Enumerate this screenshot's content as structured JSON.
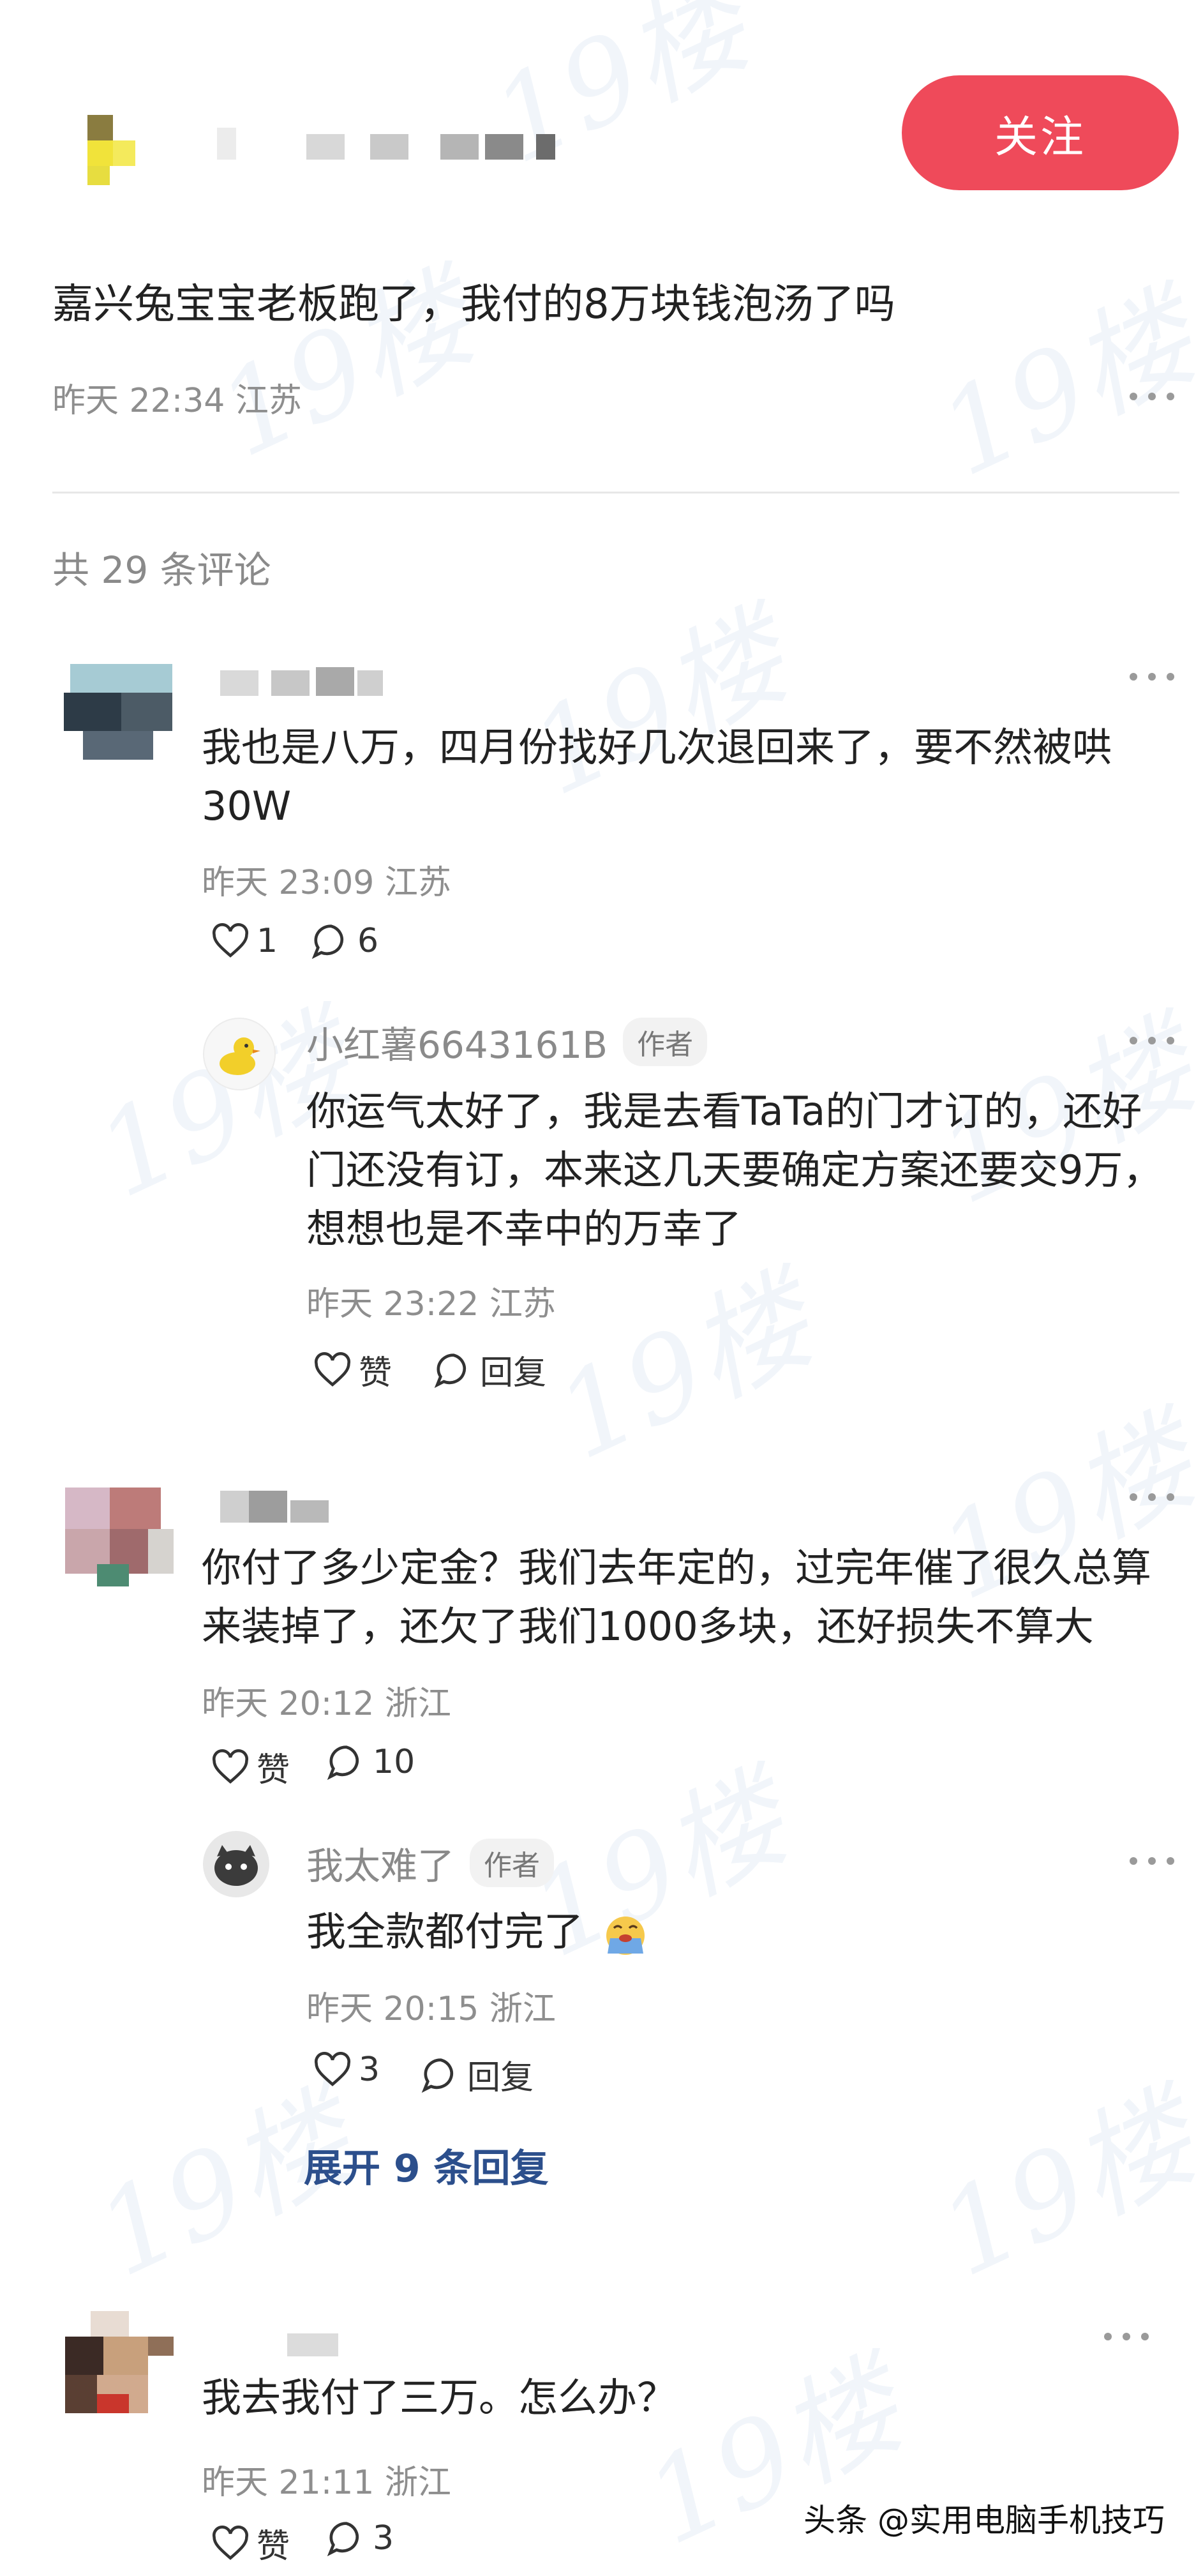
{
  "header": {
    "follow_label": "关注"
  },
  "post": {
    "title": "嘉兴兔宝宝老板跑了，我付的8万块钱泡汤了吗",
    "meta": "昨天 22:34 江苏"
  },
  "comments_count": "共 29 条评论",
  "comments": [
    {
      "line1": "我也是八万，四月份找好几次退回来了，要不然被哄",
      "line2": "30W",
      "meta": "昨天 23:09 江苏",
      "likes": "1",
      "replies": "6",
      "reply": {
        "username": "小红薯6643161B",
        "tag": "作者",
        "line1": "你运气太好了，我是去看TaTa的门才订的，还好",
        "line2": "门还没有订，本来这几天要确定方案还要交9万，",
        "line3": "想想也是不幸中的万幸了",
        "meta": "昨天 23:22 江苏",
        "like_label": "赞",
        "reply_label": "回复"
      }
    },
    {
      "line1": "你付了多少定金？我们去年定的，过完年催了很久总算",
      "line2": "来装掉了，还欠了我们1000多块，还好损失不算大",
      "meta": "昨天 20:12 浙江",
      "likes": "赞",
      "replies": "10",
      "reply": {
        "username": "我太难了",
        "tag": "作者",
        "line1": "我全款都付完了",
        "meta": "昨天 20:15 浙江",
        "likes": "3",
        "reply_label": "回复"
      },
      "expand_label": "展开 9 条回复"
    },
    {
      "line1": "我去我付了三万。怎么办？",
      "meta": "昨天 21:11 浙江",
      "likes": "赞",
      "replies": "3"
    }
  ],
  "watermark_text": "19楼",
  "footer_mark": "头条 @实用电脑手机技巧",
  "colors": {
    "follow_bg": "#ef4a5a",
    "link": "#2c4f8c",
    "meta": "#8e8e8e"
  }
}
